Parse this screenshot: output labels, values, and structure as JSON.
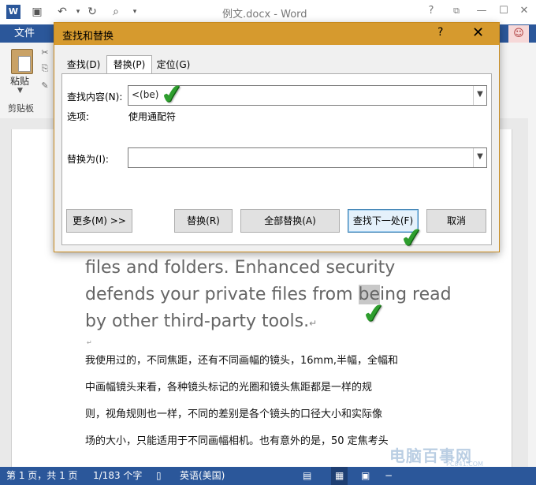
{
  "window": {
    "title": "例文.docx - Word"
  },
  "titlebar": {
    "icons": [
      "word-logo-icon",
      "save-icon",
      "undo-icon",
      "redo-icon",
      "print-preview-icon",
      "customize-qat-icon"
    ],
    "help_glyph": "?",
    "restore_glyph": "⧉",
    "minimize_glyph": "—",
    "maximize_glyph": "☐",
    "close_glyph": "✕"
  },
  "ribbon": {
    "file_tab": "文件",
    "paste_label": "粘贴",
    "clipboard_group": "剪贴板"
  },
  "dialog": {
    "title": "查找和替换",
    "help": "?",
    "close": "✕",
    "tabs": [
      {
        "label": "查找(D)"
      },
      {
        "label": "替换(P)"
      },
      {
        "label": "定位(G)"
      }
    ],
    "active_tab": "替换(P)",
    "find_label": "查找内容(N):",
    "find_value": "<(be)",
    "options_label": "选项:",
    "options_value": "使用通配符",
    "replace_label": "替换为(I):",
    "replace_value": "",
    "buttons": {
      "more": "更多(M) >>",
      "replace": "替换(R)",
      "replace_all": "全部替换(A)",
      "find_next": "查找下一处(F)",
      "cancel": "取消"
    }
  },
  "document": {
    "english": {
      "line1": "files and folders. Enhanced security",
      "line2_before": "defends your private files from ",
      "line2_highlight": "be",
      "line2_after": "ing read",
      "line3": "by other third-party tools.",
      "return_mark": "↵"
    },
    "chinese_lines": [
      "我使用过的，不同焦距，还有不同画幅的镜头，16mm,半幅，全幅和",
      "中画幅镜头来看，各种镜头标记的光圈和镜头焦距都是一样的规",
      "则，视角规则也一样，不同的差别是各个镜头的口径大小和实际像",
      "场的大小，只能适用于不同画幅相机。也有意外的是，50 定焦考头"
    ]
  },
  "statusbar": {
    "page": "第 1 页，共 1 页",
    "words": "1/183 个字",
    "language": "英语(美国)"
  },
  "watermark": {
    "text": "电脑百事网",
    "sub": "PC841.COM"
  },
  "colors": {
    "word_blue": "#2b579a",
    "dialog_title_orange": "#d69a2e",
    "check_green": "#2e9e2e"
  }
}
